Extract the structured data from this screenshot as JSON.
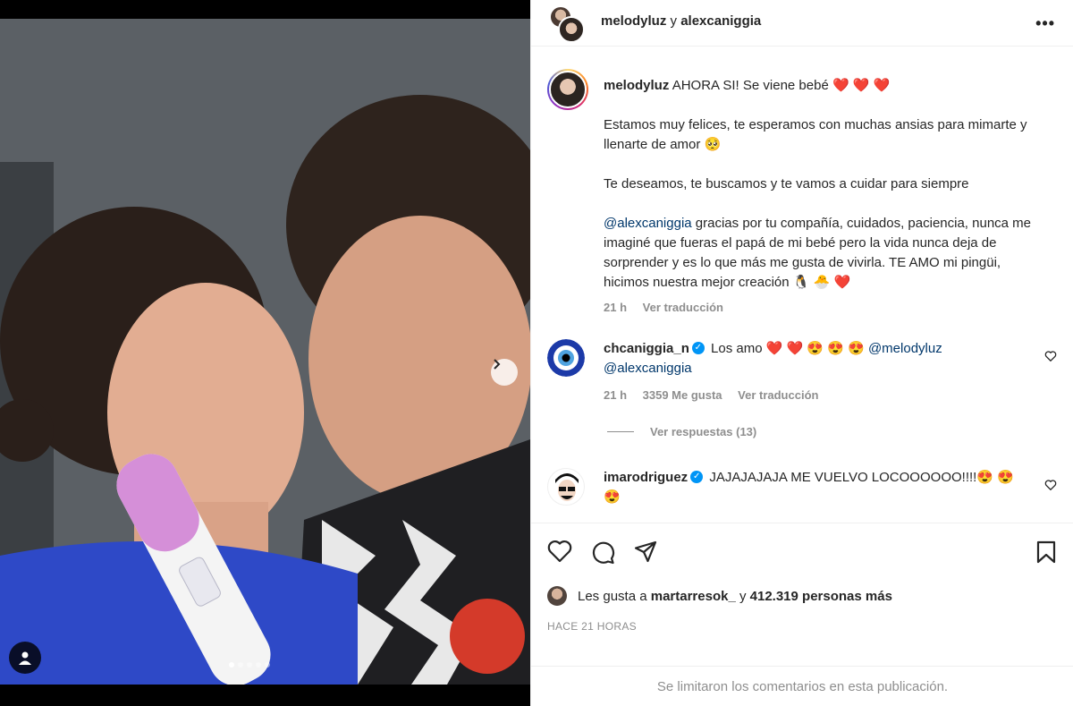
{
  "post": {
    "media": {
      "next_icon": "chevron-right-icon",
      "user_tag_icon": "user-icon",
      "carousel_dots": 5,
      "carousel_active_index": 0
    },
    "header": {
      "user1": "melodyluz",
      "connector": "y",
      "user2": "alexcaniggia",
      "more": "•••"
    },
    "caption": {
      "username": "melodyluz",
      "line1": "AHORA SI! Se viene bebé ❤️ ❤️ ❤️",
      "para2": "Estamos muy felices, te esperamos con muchas ansias para mimarte y llenarte de amor 🥺",
      "para3": "Te deseamos, te buscamos y te vamos a cuidar para siempre",
      "mention": "@alexcaniggia",
      "para4": " gracias por tu compañía, cuidados, paciencia, nunca me imaginé que fueras el papá de mi bebé pero la vida nunca deja de sorprender y es lo que más me gusta de vivirla. TE AMO mi pingüi, hicimos nuestra mejor creación 🐧 🐣 ❤️",
      "time": "21 h",
      "translate": "Ver traducción"
    },
    "comments": [
      {
        "username": "chcaniggia_n",
        "text": "Los amo ❤️ ❤️ 😍 😍 😍 ",
        "mention1": "@melodyluz",
        "mention2": "@alexcaniggia",
        "time": "21 h",
        "likes": "3359 Me gusta",
        "translate": "Ver traducción",
        "replies": "Ver respuestas (13)"
      },
      {
        "username": "imarodriguez",
        "text": "JAJAJAJAJA ME VUELVO LOCOOOOOO!!!!😍 😍 😍"
      }
    ],
    "likes": {
      "prefix": "Les gusta a",
      "user": "martarresok_",
      "connector": "y",
      "count": "412.319 personas más"
    },
    "time_ago": "HACE 21 HORAS",
    "limited_comments": "Se limitaron los comentarios en esta publicación."
  },
  "colors": {
    "link": "#00376b",
    "verified": "#0095f6",
    "muted": "#8e8e8e"
  }
}
